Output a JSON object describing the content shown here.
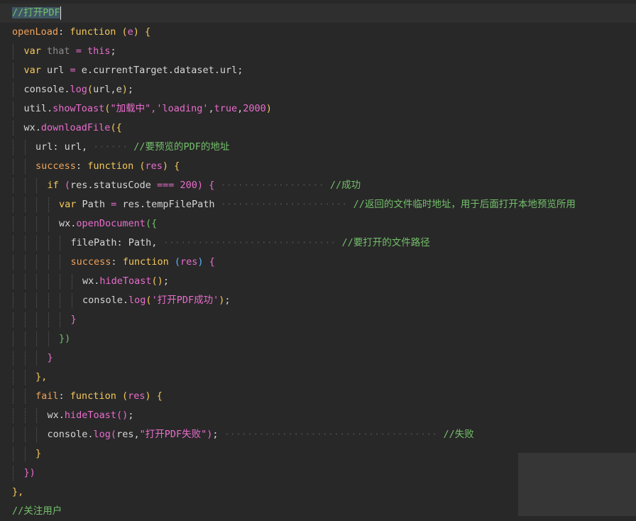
{
  "editor": {
    "lines": [
      {
        "indent": 0,
        "current": true,
        "tokens": [
          {
            "t": "//打开PDF",
            "c": "tok-comment sel"
          }
        ]
      },
      {
        "indent": 0,
        "tokens": [
          {
            "t": "openLoad",
            "c": "tok-key"
          },
          {
            "t": ":",
            "c": "tok-plain"
          },
          {
            "t": " ",
            "c": "dots"
          },
          {
            "t": "function",
            "c": "tok-kw"
          },
          {
            "t": " ",
            "c": "dots"
          },
          {
            "t": "(",
            "c": "br-y"
          },
          {
            "t": "e",
            "c": "tok-param"
          },
          {
            "t": ")",
            "c": "br-y"
          },
          {
            "t": " ",
            "c": "dots"
          },
          {
            "t": "{",
            "c": "br-y"
          }
        ]
      },
      {
        "indent": 1,
        "tokens": [
          {
            "t": "var",
            "c": "tok-var"
          },
          {
            "t": " ",
            "c": "dots"
          },
          {
            "t": "that",
            "c": "tok-muted"
          },
          {
            "t": " ",
            "c": "dots"
          },
          {
            "t": "=",
            "c": "tok-op"
          },
          {
            "t": " ",
            "c": "dots"
          },
          {
            "t": "this",
            "c": "tok-this"
          },
          {
            "t": ";",
            "c": "tok-plain"
          }
        ]
      },
      {
        "indent": 1,
        "tokens": [
          {
            "t": "var",
            "c": "tok-var"
          },
          {
            "t": " url ",
            "c": "tok-plain"
          },
          {
            "t": "=",
            "c": "tok-op"
          },
          {
            "t": " e.currentTarget.dataset.url;",
            "c": "tok-plain"
          }
        ]
      },
      {
        "indent": 1,
        "tokens": [
          {
            "t": "console.",
            "c": "tok-plain"
          },
          {
            "t": "log",
            "c": "tok-fn"
          },
          {
            "t": "(",
            "c": "br-y"
          },
          {
            "t": "url,e",
            "c": "tok-plain"
          },
          {
            "t": ")",
            "c": "br-y"
          },
          {
            "t": ";",
            "c": "tok-plain"
          }
        ]
      },
      {
        "indent": 1,
        "tokens": [
          {
            "t": "util.",
            "c": "tok-plain"
          },
          {
            "t": "showToast",
            "c": "tok-fn"
          },
          {
            "t": "(",
            "c": "br-y"
          },
          {
            "t": "\"加载中\",'loading'",
            "c": "tok-str"
          },
          {
            "t": ",",
            "c": "tok-plain"
          },
          {
            "t": "true",
            "c": "tok-bool"
          },
          {
            "t": ",",
            "c": "tok-plain"
          },
          {
            "t": "2000",
            "c": "tok-num"
          },
          {
            "t": ")",
            "c": "br-y"
          }
        ]
      },
      {
        "indent": 1,
        "tokens": [
          {
            "t": "wx.",
            "c": "tok-plain"
          },
          {
            "t": "downloadFile",
            "c": "tok-fn"
          },
          {
            "t": "({",
            "c": "br-y"
          }
        ]
      },
      {
        "indent": 2,
        "tokens": [
          {
            "t": "url",
            "c": "tok-plain"
          },
          {
            "t": ":",
            "c": "tok-plain"
          },
          {
            "t": " url,",
            "c": "tok-plain"
          },
          {
            "t": " ······ ",
            "c": "dots"
          },
          {
            "t": "//要预览的PDF的地址",
            "c": "tok-comment"
          }
        ]
      },
      {
        "indent": 2,
        "tokens": [
          {
            "t": "success",
            "c": "tok-key"
          },
          {
            "t": ":",
            "c": "tok-plain"
          },
          {
            "t": " ",
            "c": "dots"
          },
          {
            "t": "function",
            "c": "tok-kw"
          },
          {
            "t": " ",
            "c": "dots"
          },
          {
            "t": "(",
            "c": "br-y"
          },
          {
            "t": "res",
            "c": "tok-param"
          },
          {
            "t": ")",
            "c": "br-y"
          },
          {
            "t": " ",
            "c": "dots"
          },
          {
            "t": "{",
            "c": "br-y"
          }
        ]
      },
      {
        "indent": 3,
        "tokens": [
          {
            "t": "if",
            "c": "tok-kw"
          },
          {
            "t": " ",
            "c": "dots"
          },
          {
            "t": "(",
            "c": "br-m"
          },
          {
            "t": "res.statusCode ",
            "c": "tok-plain"
          },
          {
            "t": "===",
            "c": "tok-op"
          },
          {
            "t": " ",
            "c": "dots"
          },
          {
            "t": "200",
            "c": "tok-num"
          },
          {
            "t": ")",
            "c": "br-m"
          },
          {
            "t": " ",
            "c": "dots"
          },
          {
            "t": "{",
            "c": "br-m"
          },
          {
            "t": " ·················· ",
            "c": "dots"
          },
          {
            "t": "//成功",
            "c": "tok-comment"
          }
        ]
      },
      {
        "indent": 4,
        "tokens": [
          {
            "t": "var",
            "c": "tok-var"
          },
          {
            "t": " Path ",
            "c": "tok-plain"
          },
          {
            "t": "=",
            "c": "tok-op"
          },
          {
            "t": " res.tempFilePath",
            "c": "tok-plain"
          },
          {
            "t": " ······················ ",
            "c": "dots"
          },
          {
            "t": "//返回的文件临时地址，用于后面打开本地预览所用",
            "c": "tok-comment"
          }
        ]
      },
      {
        "indent": 4,
        "tokens": [
          {
            "t": "wx.",
            "c": "tok-plain"
          },
          {
            "t": "openDocument",
            "c": "tok-fn"
          },
          {
            "t": "({",
            "c": "br-g"
          }
        ]
      },
      {
        "indent": 5,
        "tokens": [
          {
            "t": "filePath",
            "c": "tok-plain"
          },
          {
            "t": ":",
            "c": "tok-plain"
          },
          {
            "t": " Path,",
            "c": "tok-plain"
          },
          {
            "t": " ······························ ",
            "c": "dots"
          },
          {
            "t": "//要打开的文件路径",
            "c": "tok-comment"
          }
        ]
      },
      {
        "indent": 5,
        "tokens": [
          {
            "t": "success",
            "c": "tok-key"
          },
          {
            "t": ":",
            "c": "tok-plain"
          },
          {
            "t": " ",
            "c": "dots"
          },
          {
            "t": "function",
            "c": "tok-kw"
          },
          {
            "t": " ",
            "c": "dots"
          },
          {
            "t": "(",
            "c": "br-b"
          },
          {
            "t": "res",
            "c": "tok-param"
          },
          {
            "t": ")",
            "c": "br-b"
          },
          {
            "t": " ",
            "c": "dots"
          },
          {
            "t": "{",
            "c": "br-m"
          }
        ]
      },
      {
        "indent": 6,
        "tokens": [
          {
            "t": "wx.",
            "c": "tok-plain"
          },
          {
            "t": "hideToast",
            "c": "tok-fn"
          },
          {
            "t": "()",
            "c": "br-y"
          },
          {
            "t": ";",
            "c": "tok-plain"
          }
        ]
      },
      {
        "indent": 6,
        "tokens": [
          {
            "t": "console.",
            "c": "tok-plain"
          },
          {
            "t": "log",
            "c": "tok-fn"
          },
          {
            "t": "(",
            "c": "br-y"
          },
          {
            "t": "'打开PDF成功'",
            "c": "tok-str"
          },
          {
            "t": ")",
            "c": "br-y"
          },
          {
            "t": ";",
            "c": "tok-plain"
          }
        ]
      },
      {
        "indent": 5,
        "tokens": [
          {
            "t": "}",
            "c": "br-m"
          }
        ]
      },
      {
        "indent": 4,
        "tokens": [
          {
            "t": "})",
            "c": "br-g"
          }
        ]
      },
      {
        "indent": 3,
        "tokens": [
          {
            "t": "}",
            "c": "br-m"
          }
        ]
      },
      {
        "indent": 2,
        "tokens": [
          {
            "t": "},",
            "c": "br-y"
          }
        ]
      },
      {
        "indent": 2,
        "tokens": [
          {
            "t": "fail",
            "c": "tok-key"
          },
          {
            "t": ":",
            "c": "tok-plain"
          },
          {
            "t": " ",
            "c": "dots"
          },
          {
            "t": "function",
            "c": "tok-kw"
          },
          {
            "t": " ",
            "c": "dots"
          },
          {
            "t": "(",
            "c": "br-y"
          },
          {
            "t": "res",
            "c": "tok-param"
          },
          {
            "t": ")",
            "c": "br-y"
          },
          {
            "t": " ",
            "c": "dots"
          },
          {
            "t": "{",
            "c": "br-y"
          }
        ]
      },
      {
        "indent": 3,
        "tokens": [
          {
            "t": "wx.",
            "c": "tok-plain"
          },
          {
            "t": "hideToast",
            "c": "tok-fn"
          },
          {
            "t": "()",
            "c": "br-m"
          },
          {
            "t": ";",
            "c": "tok-plain"
          }
        ]
      },
      {
        "indent": 3,
        "tokens": [
          {
            "t": "console.",
            "c": "tok-plain"
          },
          {
            "t": "log",
            "c": "tok-fn"
          },
          {
            "t": "(",
            "c": "br-m"
          },
          {
            "t": "res,",
            "c": "tok-plain"
          },
          {
            "t": "\"打开PDF失败\"",
            "c": "tok-str"
          },
          {
            "t": ")",
            "c": "br-m"
          },
          {
            "t": ";",
            "c": "tok-plain"
          },
          {
            "t": " ····································· ",
            "c": "dots"
          },
          {
            "t": "//失败",
            "c": "tok-comment"
          }
        ]
      },
      {
        "indent": 2,
        "tokens": [
          {
            "t": "}",
            "c": "br-y"
          }
        ]
      },
      {
        "indent": 1,
        "tokens": [
          {
            "t": "})",
            "c": "br-m"
          }
        ]
      },
      {
        "indent": 0,
        "tokens": [
          {
            "t": "},",
            "c": "br-y"
          }
        ]
      },
      {
        "indent": 0,
        "tokens": [
          {
            "t": "//关注用户",
            "c": "tok-comment"
          }
        ]
      }
    ]
  }
}
